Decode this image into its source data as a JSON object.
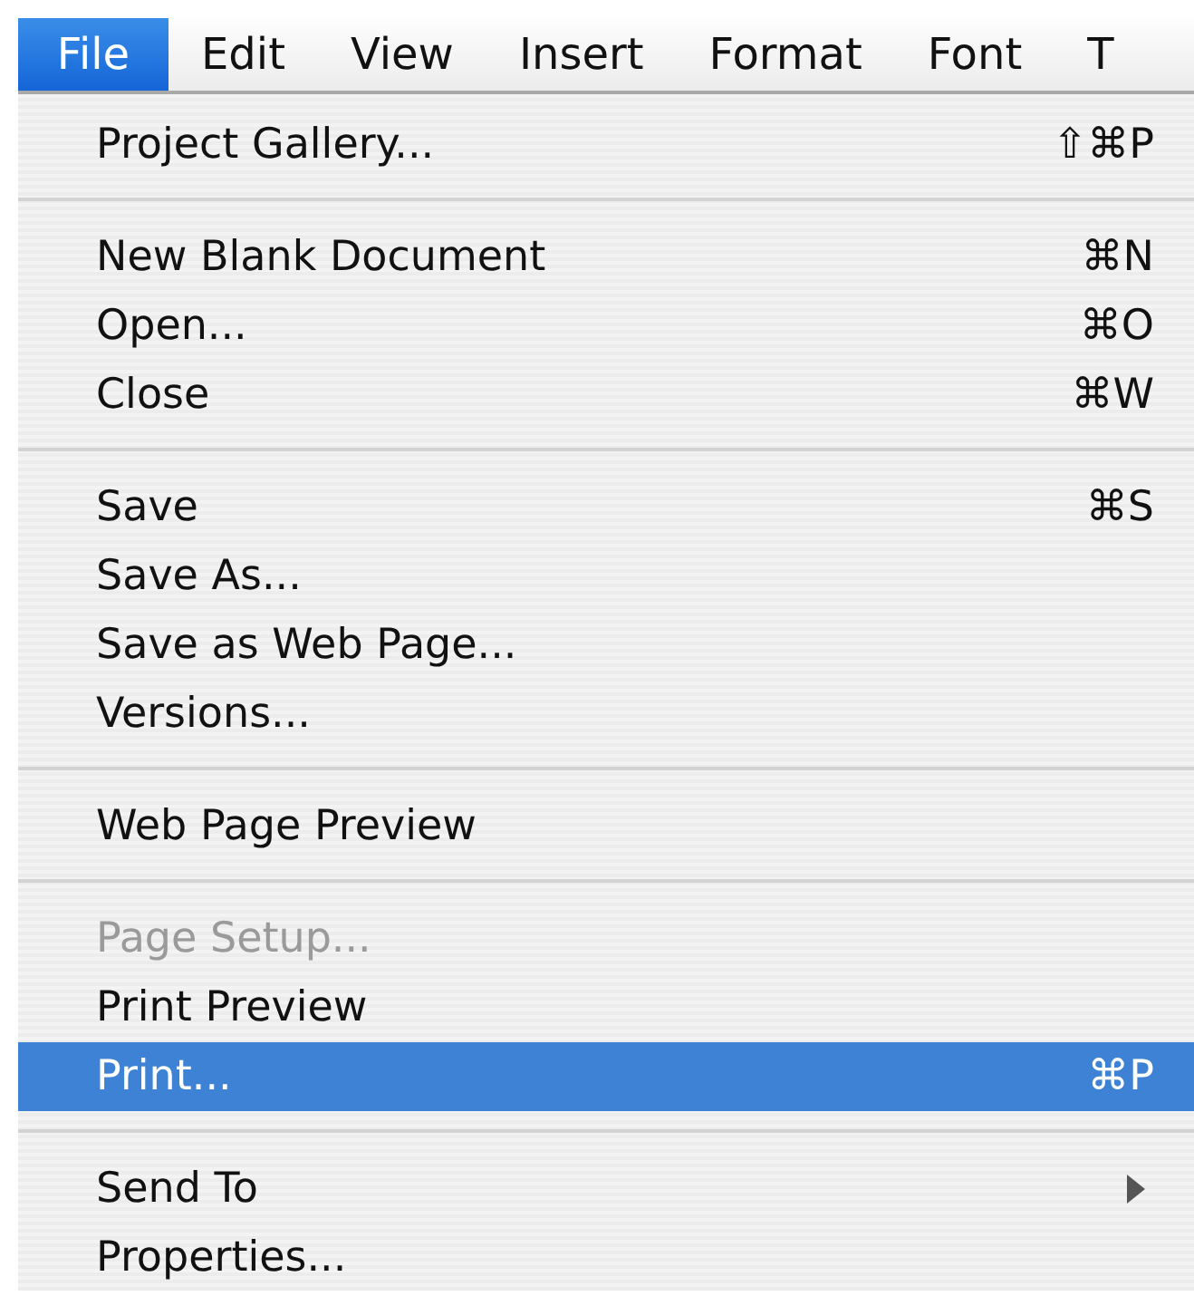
{
  "menu_bar": [
    {
      "label": "File",
      "selected": true
    },
    {
      "label": "Edit",
      "selected": false
    },
    {
      "label": "View",
      "selected": false
    },
    {
      "label": "Insert",
      "selected": false
    },
    {
      "label": "Format",
      "selected": false
    },
    {
      "label": "Font",
      "selected": false
    },
    {
      "label": "T",
      "selected": false
    }
  ],
  "file_menu": {
    "groups": [
      {
        "items": [
          {
            "label": "Project Gallery...",
            "shortcut": "⇧⌘P",
            "disabled": false,
            "selected": false,
            "submenu": false
          }
        ]
      },
      {
        "items": [
          {
            "label": "New Blank Document",
            "shortcut": "⌘N",
            "disabled": false,
            "selected": false,
            "submenu": false
          },
          {
            "label": "Open...",
            "shortcut": "⌘O",
            "disabled": false,
            "selected": false,
            "submenu": false
          },
          {
            "label": "Close",
            "shortcut": "⌘W",
            "disabled": false,
            "selected": false,
            "submenu": false
          }
        ]
      },
      {
        "items": [
          {
            "label": "Save",
            "shortcut": "⌘S",
            "disabled": false,
            "selected": false,
            "submenu": false
          },
          {
            "label": "Save As...",
            "disabled": false,
            "selected": false,
            "submenu": false
          },
          {
            "label": "Save as Web Page...",
            "disabled": false,
            "selected": false,
            "submenu": false
          },
          {
            "label": "Versions...",
            "disabled": false,
            "selected": false,
            "submenu": false
          }
        ]
      },
      {
        "items": [
          {
            "label": "Web Page Preview",
            "disabled": false,
            "selected": false,
            "submenu": false
          }
        ]
      },
      {
        "items": [
          {
            "label": "Page Setup...",
            "disabled": true,
            "selected": false,
            "submenu": false
          },
          {
            "label": "Print Preview",
            "disabled": false,
            "selected": false,
            "submenu": false
          },
          {
            "label": "Print...",
            "shortcut": "⌘P",
            "disabled": false,
            "selected": true,
            "submenu": false
          }
        ]
      },
      {
        "items": [
          {
            "label": "Send To",
            "disabled": false,
            "selected": false,
            "submenu": true
          },
          {
            "label": "Properties...",
            "disabled": false,
            "selected": false,
            "submenu": false
          }
        ]
      }
    ]
  }
}
